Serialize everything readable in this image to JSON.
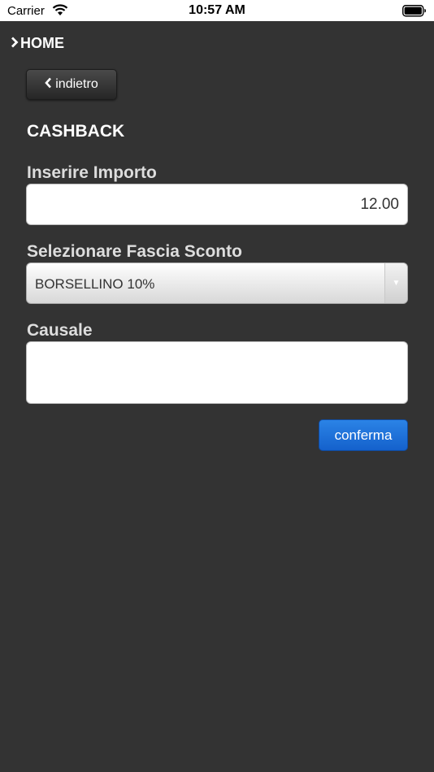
{
  "status_bar": {
    "carrier": "Carrier",
    "time": "10:57 AM"
  },
  "nav": {
    "home_label": "HOME",
    "back_label": "indietro"
  },
  "page": {
    "title": "CASHBACK"
  },
  "form": {
    "amount_label": "Inserire Importo",
    "amount_value": "12.00",
    "discount_label": "Selezionare Fascia Sconto",
    "discount_selected": "BORSELLINO 10%",
    "causale_label": "Causale",
    "causale_value": "",
    "confirm_label": "conferma"
  },
  "colors": {
    "background": "#333333",
    "confirm_button": "#1a6fd8"
  }
}
